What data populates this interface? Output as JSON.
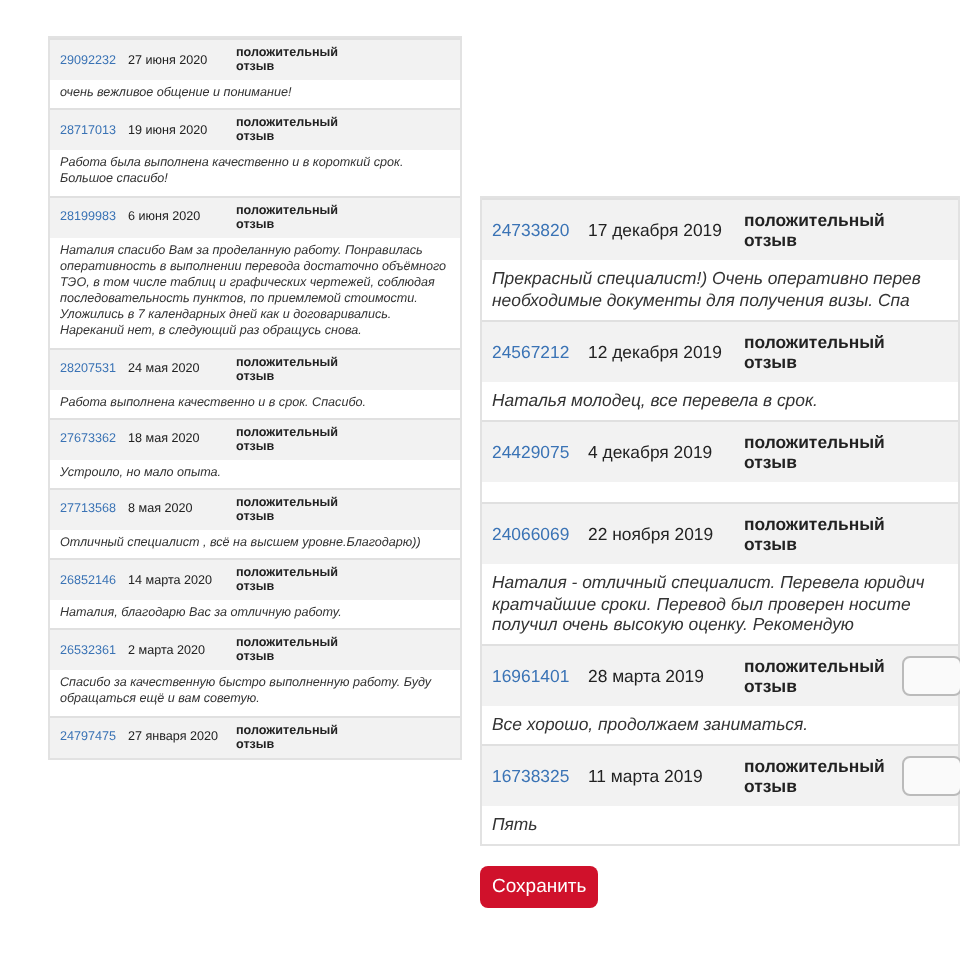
{
  "left_reviews": [
    {
      "order": "29092232",
      "date": "27 июня 2020",
      "verdict": "положительный отзыв",
      "comment": "очень вежливое общение и понимание!"
    },
    {
      "order": "28717013",
      "date": "19 июня 2020",
      "verdict": "положительный отзыв",
      "comment": "Работа была выполнена качественно и в короткий срок. Большое спасибо!"
    },
    {
      "order": "28199983",
      "date": "6 июня 2020",
      "verdict": "положительный отзыв",
      "comment": "Наталия спасибо Вам за проделанную работу. Понравилась оперативность в выполнении перевода достаточно объёмного ТЭО, в том числе таблиц и графических чертежей, соблюдая последовательность пунктов, по приемлемой стоимости. Уложились в 7 календарных дней как и договаривались. Нареканий нет, в следующий раз обращусь снова."
    },
    {
      "order": "28207531",
      "date": "24 мая 2020",
      "verdict": "положительный отзыв",
      "comment": "Работа выполнена качественно и в срок. Спасибо."
    },
    {
      "order": "27673362",
      "date": "18 мая 2020",
      "verdict": "положительный отзыв",
      "comment": "Устроило, но мало опыта."
    },
    {
      "order": "27713568",
      "date": "8 мая 2020",
      "verdict": "положительный отзыв",
      "comment": "Отличный специалист , всё на высшем уровне.Благодарю))"
    },
    {
      "order": "26852146",
      "date": "14 марта 2020",
      "verdict": "положительный отзыв",
      "comment": "Наталия, благодарю Вас за отличную работу."
    },
    {
      "order": "26532361",
      "date": "2 марта 2020",
      "verdict": "положительный отзыв",
      "comment": "Спасибо за качественную быстро выполненную работу. Буду обращаться ещё и вам советую."
    },
    {
      "order": "24797475",
      "date": "27 января 2020",
      "verdict": "положительный отзыв"
    }
  ],
  "right_reviews": [
    {
      "order": "24733820",
      "date": "17 декабря 2019",
      "verdict": "положительный отзыв",
      "comment_lines": [
        "Прекрасный специалист!) Очень оперативно перев",
        "необходимые документы для получения визы. Спа"
      ],
      "action_button": false
    },
    {
      "order": "24567212",
      "date": "12 декабря 2019",
      "verdict": "положительный отзыв",
      "comment_lines": [
        "Наталья молодец, все перевела в срок."
      ],
      "action_button": false
    },
    {
      "order": "24429075",
      "date": "4 декабря 2019",
      "verdict": "положительный отзыв",
      "action_button": false
    },
    {
      "order": "24066069",
      "date": "22 ноября 2019",
      "verdict": "положительный отзыв",
      "comment_lines": [
        "Наталия - отличный специалист. Перевела юридич",
        "кратчайшие сроки. Перевод был проверен носите",
        "получил очень высокую оценку. Рекомендую"
      ],
      "action_button": false
    },
    {
      "order": "16961401",
      "date": "28 марта 2019",
      "verdict": "положительный отзыв",
      "comment_lines": [
        "Все хорошо, продолжаем заниматься."
      ],
      "action_button": true
    },
    {
      "order": "16738325",
      "date": "11 марта 2019",
      "verdict": "положительный отзыв",
      "comment_lines": [
        "Пять"
      ],
      "action_button": true
    }
  ],
  "save_button": "Сохранить"
}
